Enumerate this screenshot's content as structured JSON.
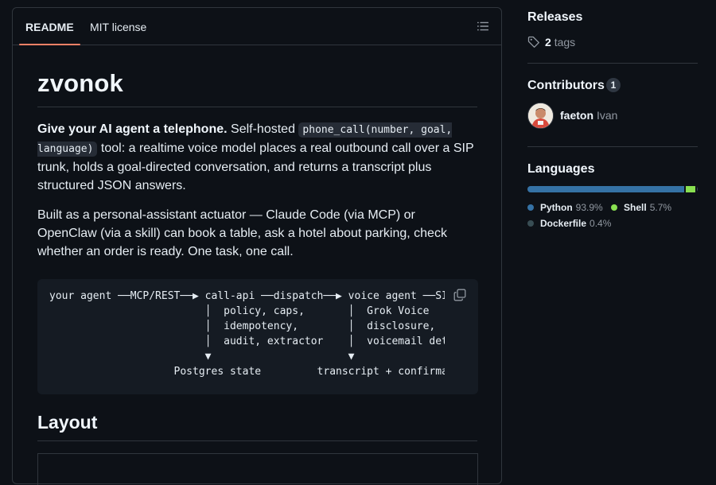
{
  "readme": {
    "tabs": [
      {
        "label": "README",
        "active": true
      },
      {
        "label": "MIT license",
        "active": false
      }
    ],
    "title": "zvonok",
    "intro": {
      "bold": "Give your AI agent a telephone.",
      "before_code": "Self-hosted",
      "code": "phone_call(number, goal, language)",
      "after_code": "tool: a realtime voice model places a real outbound call over a SIP trunk, holds a goal-directed conversation, and returns a transcript plus structured JSON answers."
    },
    "para2": "Built as a personal-assistant actuator — Claude Code (via MCP) or OpenClaw (via a skill) can book a table, ask a hotel about parking, check whether an order is ready. One task, one call.",
    "code_block": "your agent ──MCP/REST──▶ call-api ──dispatch──▶ voice agent ──SIP──▶\n                         │  policy, caps,       │  Grok Voice\n                         │  idempotency,        │  disclosure,\n                         │  audit, extractor    │  voicemail detect\n                         ▼                      ▼\n                    Postgres state         transcript + confirmation",
    "layout_heading": "Layout"
  },
  "sidebar": {
    "releases": {
      "heading": "Releases",
      "tag_count": "2",
      "tag_label": "tags"
    },
    "contributors": {
      "heading": "Contributors",
      "count": "1",
      "people": [
        {
          "login": "faeton",
          "name": "Ivan"
        }
      ]
    },
    "languages": {
      "heading": "Languages",
      "items": [
        {
          "name": "Python",
          "percent": "93.9%",
          "value": 93.9,
          "color": "#3572A5"
        },
        {
          "name": "Shell",
          "percent": "5.7%",
          "value": 5.7,
          "color": "#89e051"
        },
        {
          "name": "Dockerfile",
          "percent": "0.4%",
          "value": 0.4,
          "color": "#384d54"
        }
      ]
    }
  },
  "colors": {
    "background": "#0d1117",
    "border": "#30363d",
    "tab_underline": "#f78166",
    "muted": "#9198a1"
  }
}
